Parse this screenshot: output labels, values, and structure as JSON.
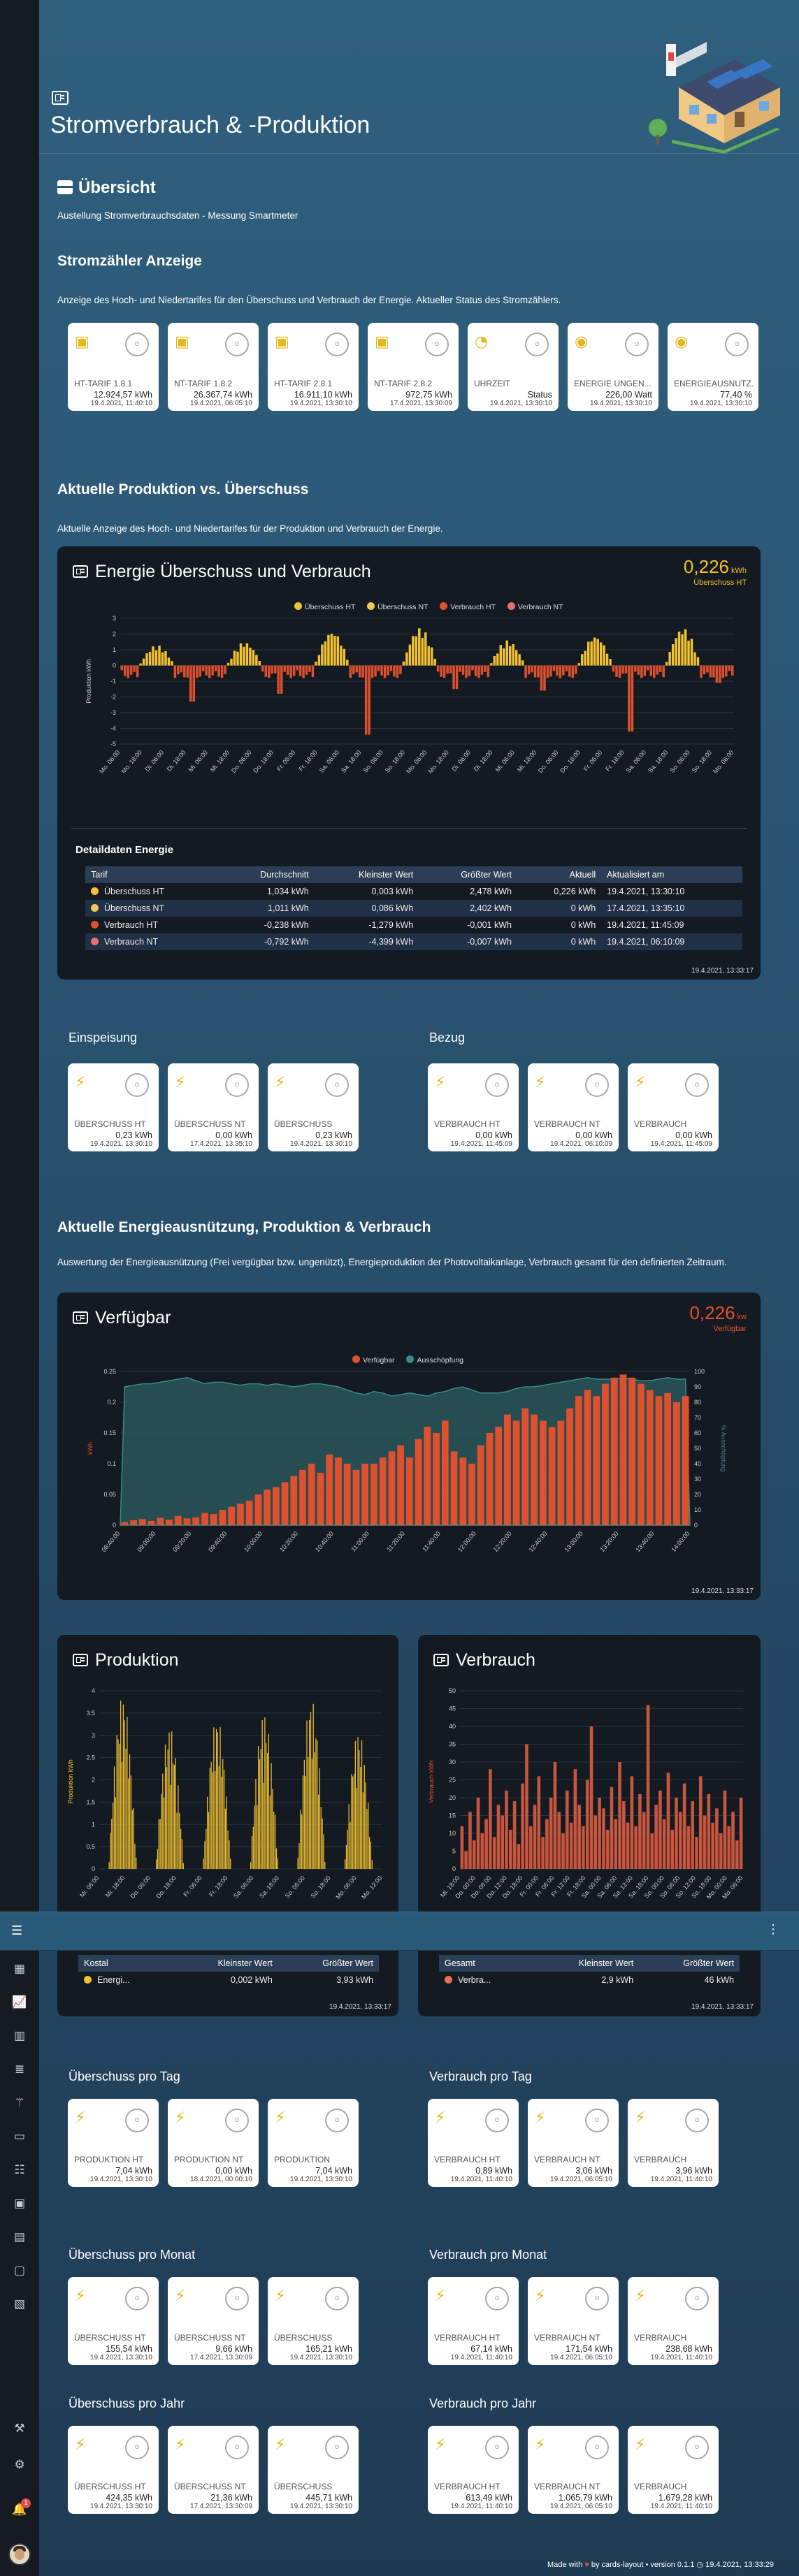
{
  "header": {
    "title": "Stromverbrauch & -Produktion"
  },
  "sidebar": {
    "items": [
      "menu-icon",
      "dashboard-icon",
      "chart-line-icon",
      "bar-chart-icon",
      "list-icon",
      "solar-panel-icon",
      "monitor-icon",
      "list-alt-icon",
      "image-icon",
      "calendar-icon",
      "display-icon",
      "collection-icon",
      "hammer-icon",
      "gear-icon",
      "bell-icon"
    ],
    "notifications": "1"
  },
  "overview": {
    "title": "Übersicht",
    "subtitle": "Austellung Stromverbrauchsdaten - Messung Smartmeter"
  },
  "meter": {
    "title": "Stromzähler Anzeige",
    "subtitle": "Anzeige des Hoch- und Niedertarifes für den Überschuss und Verbrauch der Energie. Aktueller Status des Stromzählers.",
    "tiles": [
      {
        "label": "HT-TARIF 1.8.1",
        "value": "12.924,57 kWh",
        "time": "19.4.2021, 11:40:10",
        "icon": "meter-icon"
      },
      {
        "label": "NT-TARIF 1.8.2",
        "value": "26.367,74 kWh",
        "time": "19.4.2021, 06:05:10",
        "icon": "meter-icon"
      },
      {
        "label": "HT-TARIF 2.8.1",
        "value": "16.911,10 kWh",
        "time": "19.4.2021, 13:30:10",
        "icon": "meter-icon"
      },
      {
        "label": "NT-TARIF 2.8.2",
        "value": "972,75 kWh",
        "time": "17.4.2021, 13:30:09",
        "icon": "meter-icon"
      },
      {
        "label": "UHRZEIT",
        "value": "Status",
        "time": "19.4.2021, 13:30:10",
        "icon": "clock-icon"
      },
      {
        "label": "ENERGIE UNGEN...",
        "value": "226,00 Watt",
        "time": "19.4.2021, 13:30:10",
        "icon": "eye-icon"
      },
      {
        "label": "ENERGIEAUSNUTZ...",
        "value": "77,40 %",
        "time": "19.4.2021, 13:30:10",
        "icon": "eye-icon"
      }
    ]
  },
  "prod_section": {
    "title": "Aktuelle Produktion vs. Überschuss",
    "subtitle": "Aktuelle Anzeige des Hoch- und Niedertarifes für der Produktion und Verbrauch der Energie."
  },
  "energy_panel": {
    "title": "Energie Überschuss und Verbrauch",
    "value": "0,226",
    "unit": "kWh",
    "value_label": "Überschuss HT",
    "table_title": "Detaildaten Energie",
    "timestamp": "19.4.2021, 13:33:17",
    "table_headers": [
      "Tarif",
      "Durchschnitt",
      "Kleinster Wert",
      "Größter Wert",
      "Aktuell",
      "Aktualisiert am"
    ],
    "rows": [
      {
        "name": "Überschuss HT",
        "color": "#f2c230",
        "avg": "1,034 kWh",
        "min": "0,003 kWh",
        "max": "2,478 kWh",
        "current": "0,226 kWh",
        "updated": "19.4.2021, 13:30:10"
      },
      {
        "name": "Überschuss NT",
        "color": "#f0c85a",
        "avg": "1,011 kWh",
        "min": "0,086 kWh",
        "max": "2,402 kWh",
        "current": "0 kWh",
        "updated": "17.4.2021, 13:35:10"
      },
      {
        "name": "Verbrauch HT",
        "color": "#e0502e",
        "avg": "-0,238 kWh",
        "min": "-1,279 kWh",
        "max": "-0,001 kWh",
        "current": "0 kWh",
        "updated": "19.4.2021, 11:45:09"
      },
      {
        "name": "Verbrauch NT",
        "color": "#e87070",
        "avg": "-0,792 kWh",
        "min": "-4,399 kWh",
        "max": "-0,007 kWh",
        "current": "0 kWh",
        "updated": "19.4.2021, 06:10:09"
      }
    ]
  },
  "einspeisung": {
    "title": "Einspeisung",
    "tiles": [
      {
        "label": "ÜBERSCHUSS HT",
        "value": "0,23 kWh",
        "time": "19.4.2021, 13:30:10"
      },
      {
        "label": "ÜBERSCHUSS NT",
        "value": "0,00 kWh",
        "time": "17.4.2021, 13:35:10"
      },
      {
        "label": "ÜBERSCHUSS",
        "value": "0,23 kWh",
        "time": "19.4.2021, 13:30:10"
      }
    ]
  },
  "bezug": {
    "title": "Bezug",
    "tiles": [
      {
        "label": "VERBRAUCH HT",
        "value": "0,00 kWh",
        "time": "19.4.2021, 11:45:09"
      },
      {
        "label": "VERBRAUCH NT",
        "value": "0,00 kWh",
        "time": "19.4.2021, 06:10:09"
      },
      {
        "label": "VERBRAUCH",
        "value": "0,00 kWh",
        "time": "19.4.2021, 11:45:09"
      }
    ]
  },
  "util_section": {
    "title": "Aktuelle Energieausnützung, Produktion & Verbrauch",
    "subtitle": "Auswertung der Energieausnützung (Frei vergügbar bzw. ungenützt), Energieproduktion der Photovoltaikanlage, Verbrauch gesamt für den definierten Zeitraum."
  },
  "verfuegbar": {
    "title": "Verfügbar",
    "value": "0,226",
    "unit": "kw",
    "value_label": "Verfügbar",
    "timestamp": "19.4.2021, 13:33:17"
  },
  "produktion": {
    "title": "Produktion",
    "table_headers": [
      "Kostal",
      "Kleinster Wert",
      "Größter Wert"
    ],
    "row": {
      "name": "Energi...",
      "min": "0,002 kWh",
      "max": "3,93 kWh"
    },
    "timestamp": "19.4.2021, 13:33:17"
  },
  "verbrauch": {
    "title": "Verbrauch",
    "table_headers": [
      "Gesamt",
      "Kleinster Wert",
      "Größter Wert"
    ],
    "row": {
      "name": "Verbra...",
      "min": "2,9 kWh",
      "max": "46 kWh"
    },
    "timestamp": "19.4.2021, 13:33:17"
  },
  "ueber_tag": {
    "title": "Überschuss pro Tag",
    "tiles": [
      {
        "label": "PRODUKTION HT",
        "value": "7,04 kWh",
        "time": "19.4.2021, 13:30:10"
      },
      {
        "label": "PRODUKTION NT",
        "value": "0,00 kWh",
        "time": "18.4.2021, 00:00:10"
      },
      {
        "label": "PRODUKTION",
        "value": "7,04 kWh",
        "time": "19.4.2021, 13:30:10"
      }
    ]
  },
  "verb_tag": {
    "title": "Verbrauch pro Tag",
    "tiles": [
      {
        "label": "VERBRAUCH HT",
        "value": "0,89 kWh",
        "time": "19.4.2021, 11:40:10"
      },
      {
        "label": "VERBRAUCH NT",
        "value": "3,06 kWh",
        "time": "19.4.2021, 06:05:10"
      },
      {
        "label": "VERBRAUCH",
        "value": "3,96 kWh",
        "time": "19.4.2021, 11:40:10"
      }
    ]
  },
  "ueber_monat": {
    "title": "Überschuss pro Monat",
    "tiles": [
      {
        "label": "ÜBERSCHUSS HT",
        "value": "155,54 kWh",
        "time": "19.4.2021, 13:30:10"
      },
      {
        "label": "ÜBERSCHUSS NT",
        "value": "9,66 kWh",
        "time": "17.4.2021, 13:30:09"
      },
      {
        "label": "ÜBERSCHUSS",
        "value": "165,21 kWh",
        "time": "19.4.2021, 13:30:10"
      }
    ]
  },
  "verb_monat": {
    "title": "Verbrauch pro Monat",
    "tiles": [
      {
        "label": "VERBRAUCH HT",
        "value": "67,14 kWh",
        "time": "19.4.2021, 11:40:10"
      },
      {
        "label": "VERBRAUCH NT",
        "value": "171,54 kWh",
        "time": "19.4.2021, 06:05:10"
      },
      {
        "label": "VERBRAUCH",
        "value": "238,68 kWh",
        "time": "19.4.2021, 11:40:10"
      }
    ]
  },
  "ueber_jahr": {
    "title": "Überschuss pro Jahr",
    "tiles": [
      {
        "label": "ÜBERSCHUSS HT",
        "value": "424,35 kWh",
        "time": "19.4.2021, 13:30:10"
      },
      {
        "label": "ÜBERSCHUSS NT",
        "value": "21,36 kWh",
        "time": "17.4.2021, 13:30:09"
      },
      {
        "label": "ÜBERSCHUSS",
        "value": "445,71 kWh",
        "time": "19.4.2021, 13:30:10"
      }
    ]
  },
  "verb_jahr": {
    "title": "Verbrauch pro Jahr",
    "tiles": [
      {
        "label": "VERBRAUCH HT",
        "value": "613,49 kWh",
        "time": "19.4.2021, 11:40:10"
      },
      {
        "label": "VERBRAUCH NT",
        "value": "1.065,79 kWh",
        "time": "19.4.2021, 06:05:10"
      },
      {
        "label": "VERBRAUCH",
        "value": "1.679,28 kWh",
        "time": "19.4.2021, 11:40:10"
      }
    ]
  },
  "footer": {
    "made_with": "Made with",
    "by": "by cards-layout • version 0.1.1",
    "timestamp": "19.4.2021, 13:33:29"
  },
  "colors": {
    "yellow": "#f2c230",
    "red": "#e0502e",
    "teal": "#3a8a8a"
  },
  "chart_data": [
    {
      "type": "bar",
      "id": "energie",
      "legend": [
        "Überschuss HT",
        "Überschuss NT",
        "Verbrauch HT",
        "Verbrauch NT"
      ],
      "ylabel": "Produktion kWh",
      "ylim": [
        -5,
        3
      ],
      "x_ticks": [
        "Mo. 06:00",
        "Mo. 18:00",
        "Di. 06:00",
        "Di. 18:00",
        "Mi. 06:00",
        "Mi. 18:00",
        "Do. 06:00",
        "Do. 18:00",
        "Fr. 06:00",
        "Fr. 18:00",
        "Sa. 06:00",
        "Sa. 18:00",
        "So. 06:00",
        "So. 18:00",
        "Mo. 06:00",
        "Mo. 18:00",
        "Di. 06:00",
        "Di. 18:00",
        "Mi. 06:00",
        "Mi. 18:00",
        "Do. 06:00",
        "Do. 18:00",
        "Fr. 06:00",
        "Fr. 18:00",
        "Sa. 06:00",
        "Sa. 18:00",
        "So. 06:00",
        "So. 18:00",
        "Mo. 06:00"
      ],
      "y_ticks": [
        3,
        2,
        1,
        0,
        -1,
        -2,
        -3,
        -4,
        -5
      ],
      "days": [
        {
          "peak": 1.3
        },
        {
          "peak": 1.5
        },
        {
          "peak": 2.2
        },
        {
          "peak": 2.4
        },
        {
          "peak": 1.6
        },
        {
          "peak": 1.9
        },
        {
          "peak": 2.4
        }
      ],
      "night_dips": [
        {
          "min": -2.3
        },
        {
          "min": -1.8
        },
        {
          "min": -4.4
        },
        {
          "min": -1.5
        },
        {
          "min": -1.6
        },
        {
          "min": -4.2
        },
        {
          "min": -1.1
        }
      ]
    },
    {
      "type": "bar",
      "id": "verfuegbar",
      "legend": [
        "Verfügbar",
        "Ausschöpfung"
      ],
      "ylabel": "kWh",
      "y2label": "% Ausschöpfung",
      "ylim": [
        0,
        0.25
      ],
      "y2lim": [
        0,
        100
      ],
      "x_ticks": [
        "08:40:00",
        "09:00:00",
        "09:20:00",
        "09:40:00",
        "10:00:00",
        "10:20:00",
        "10:40:00",
        "11:00:00",
        "11:20:00",
        "11:40:00",
        "12:00:00",
        "12:20:00",
        "12:40:00",
        "13:00:00",
        "13:20:00",
        "13:40:00",
        "14:00:00"
      ],
      "y_ticks": [
        0.25,
        0.2,
        0.15,
        0.1,
        0.05,
        0
      ],
      "y2_ticks": [
        100,
        90,
        80,
        70,
        60,
        50,
        40,
        30,
        20,
        10,
        0
      ],
      "values": [
        0.005,
        0.008,
        0.01,
        0.007,
        0.012,
        0.009,
        0.015,
        0.011,
        0.013,
        0.02,
        0.018,
        0.025,
        0.03,
        0.035,
        0.04,
        0.05,
        0.058,
        0.062,
        0.07,
        0.08,
        0.09,
        0.1,
        0.085,
        0.115,
        0.11,
        0.1,
        0.09,
        0.1,
        0.1,
        0.11,
        0.12,
        0.13,
        0.11,
        0.14,
        0.16,
        0.15,
        0.17,
        0.12,
        0.11,
        0.1,
        0.13,
        0.15,
        0.16,
        0.18,
        0.17,
        0.19,
        0.18,
        0.17,
        0.16,
        0.17,
        0.19,
        0.21,
        0.22,
        0.21,
        0.23,
        0.24,
        0.245,
        0.24,
        0.23,
        0.22,
        0.21,
        0.215,
        0.2,
        0.21
      ],
      "utilization": [
        90,
        91,
        92,
        92,
        93,
        94,
        95,
        96,
        94,
        92,
        93,
        93,
        92,
        91,
        92,
        92,
        91,
        92,
        91,
        90,
        91,
        92,
        92,
        91,
        90,
        88,
        86,
        85,
        87,
        86,
        84,
        85,
        86,
        85,
        84,
        86,
        87,
        89,
        90,
        88,
        86,
        86,
        86,
        87,
        89,
        90,
        90,
        91,
        92,
        93,
        94,
        95,
        96,
        95,
        95,
        95,
        96,
        95,
        94,
        94,
        95,
        96,
        95,
        95
      ]
    },
    {
      "type": "bar",
      "id": "produktion",
      "ylabel": "Produktion kWh",
      "ylim": [
        0,
        4
      ],
      "y_ticks": [
        4,
        3.5,
        3,
        2.5,
        2,
        1.5,
        1,
        0.5,
        0
      ],
      "x_ticks": [
        "Mi. 06:00",
        "Mi. 18:00",
        "Do. 06:00",
        "Do. 18:00",
        "Fr. 06:00",
        "Fr. 18:00",
        "Sa. 06:00",
        "Sa. 18:00",
        "So. 06:00",
        "So. 18:00",
        "Mo. 06:00",
        "Mo. 12:00"
      ],
      "day_peaks": [
        3.9,
        3.2,
        3.4,
        3.5,
        3.8,
        3.1
      ]
    },
    {
      "type": "bar",
      "id": "verbrauch",
      "ylabel": "Verbrauch kWh",
      "ylim": [
        0,
        50
      ],
      "y_ticks": [
        50,
        45,
        40,
        35,
        30,
        25,
        20,
        15,
        10,
        5,
        0
      ],
      "x_ticks": [
        "Mi. 18:00",
        "Do. 00:00",
        "Do. 06:00",
        "Do. 12:00",
        "Do. 18:00",
        "Fr. 00:00",
        "Fr. 06:00",
        "Fr. 12:00",
        "Fr. 18:00",
        "Sa. 00:00",
        "Sa. 06:00",
        "Sa. 12:00",
        "Sa. 18:00",
        "So. 00:00",
        "So. 06:00",
        "So. 12:00",
        "So. 18:00",
        "Mo. 00:00",
        "Mo. 06:00"
      ],
      "values": [
        12,
        5,
        16,
        8,
        20,
        10,
        14,
        28,
        9,
        18,
        15,
        22,
        11,
        19,
        7,
        24,
        35,
        12,
        18,
        26,
        9,
        14,
        20,
        30,
        16,
        10,
        22,
        13,
        28,
        18,
        12,
        25,
        40,
        15,
        20,
        17,
        11,
        23,
        14,
        30,
        19,
        13,
        26,
        12,
        21,
        16,
        46,
        10,
        18,
        22,
        14,
        27,
        11,
        20,
        16,
        24,
        12,
        19,
        9,
        26,
        15,
        21,
        13,
        17,
        10,
        22,
        12,
        16,
        8,
        20
      ]
    }
  ]
}
